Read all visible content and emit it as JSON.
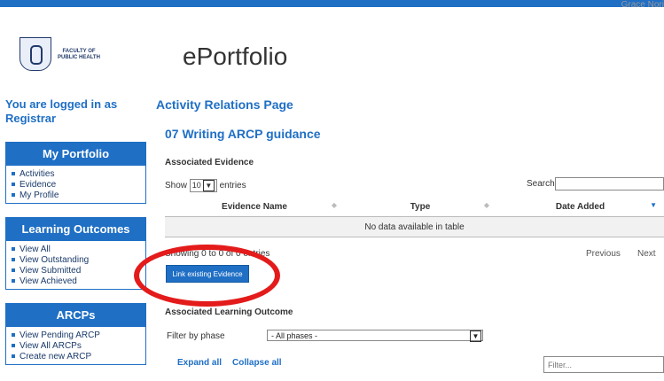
{
  "header": {
    "user_name": "Grace Nori",
    "app_title": "ePortfolio",
    "logo_text": "FACULTY OF PUBLIC HEALTH"
  },
  "sidebar": {
    "logged_in": "You are logged in as Registrar",
    "portfolio": {
      "title": "My Portfolio",
      "items": [
        "Activities",
        "Evidence",
        "My Profile"
      ]
    },
    "outcomes": {
      "title": "Learning Outcomes",
      "items": [
        "View All",
        "View Outstanding",
        "View Submitted",
        "View Achieved"
      ]
    },
    "arcps": {
      "title": "ARCPs",
      "items": [
        "View Pending ARCP",
        "View All ARCPs",
        "Create new ARCP"
      ]
    }
  },
  "main": {
    "page_title": "Activity Relations Page",
    "activity_title": "07 Writing ARCP guidance",
    "evidence": {
      "heading": "Associated Evidence",
      "show": "Show",
      "entries_value": "10",
      "entries": "entries",
      "search_label": "Search:",
      "columns": [
        "Evidence Name",
        "Type",
        "Date Added"
      ],
      "empty": "No data available in table",
      "info": "Showing 0 to 0 of 0 entries",
      "previous": "Previous",
      "next": "Next",
      "link_button": "Link existing Evidence"
    },
    "outcome": {
      "heading": "Associated Learning Outcome",
      "filter_label": "Filter by phase",
      "phase_value": "- All phases -",
      "expand_all": "Expand all",
      "collapse_all": "Collapse all",
      "filter_placeholder": "Filter..."
    }
  },
  "colors": {
    "accent": "#1f6fc5",
    "annotation": "#e41b1b"
  }
}
